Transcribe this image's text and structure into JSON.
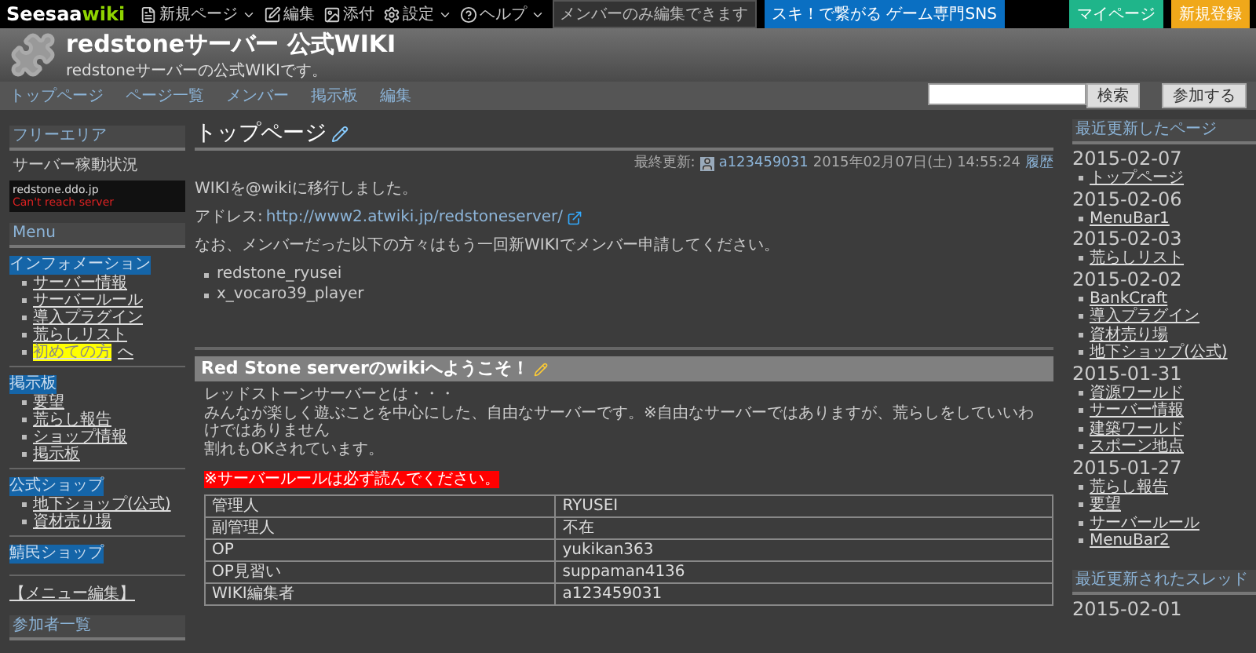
{
  "topbar": {
    "logo": {
      "part_1": "Seesaa",
      "part_2": "wiki"
    },
    "menus": [
      {
        "label": "新規ページ",
        "kind": "dropdown"
      },
      {
        "label": "編集",
        "kind": "plain"
      },
      {
        "label": "添付",
        "kind": "plain"
      },
      {
        "label": "設定",
        "kind": "dropdown"
      },
      {
        "label": "ヘルプ",
        "kind": "dropdown"
      }
    ],
    "notice": "メンバーのみ編集できます",
    "banner": "スキ！で繋がる ゲーム専門SNS",
    "buttons": [
      {
        "label": "マイページ",
        "color": "#1fb58a"
      },
      {
        "label": "新規登録",
        "color": "#f0a81a"
      }
    ]
  },
  "header": {
    "title": "redstoneサーバー 公式WIKI",
    "subtitle": "redstoneサーバーの公式WIKIです。"
  },
  "nav": {
    "links": [
      "トップページ",
      "ページ一覧",
      "メンバー",
      "掲示板",
      "編集"
    ],
    "search_button": "検索",
    "join_button": "参加する"
  },
  "sidebar": {
    "free_area_title": "フリーエリア",
    "status_label": "サーバー稼動状況",
    "server_host": "redstone.ddo.jp",
    "server_status": "Can't reach server",
    "menu_title": "Menu",
    "sections": [
      {
        "title": "インフォメーション",
        "items": [
          {
            "label": "サーバー情報",
            "highlight": false
          },
          {
            "label": "サーバールール",
            "highlight": false
          },
          {
            "label": "導入プラグイン",
            "highlight": false
          },
          {
            "label": "荒らしリスト",
            "highlight": false
          },
          {
            "label": "初めての方",
            "highlight": true,
            "suffix": "へ"
          }
        ]
      },
      {
        "title": "掲示板",
        "items": [
          {
            "label": "要望",
            "highlight": false
          },
          {
            "label": "荒らし報告",
            "highlight": false
          },
          {
            "label": "ショップ情報",
            "highlight": false
          },
          {
            "label": "掲示板",
            "highlight": false
          }
        ]
      },
      {
        "title": "公式ショップ",
        "items": [
          {
            "label": "地下ショップ(公式)",
            "highlight": false
          },
          {
            "label": "資材売り場",
            "highlight": false
          }
        ]
      },
      {
        "title": "鯖民ショップ"
      }
    ],
    "menu_edit": "【メニュー編集】",
    "members_title": "参加者一覧"
  },
  "page": {
    "title": "トップページ",
    "updated_label": "最終更新:",
    "updated_by": "a123459031",
    "updated_at": "2015年02月07日(土) 14:55:24",
    "history": "履歴",
    "intro": "WIKIを@wikiに移行しました。",
    "address_label": "アドレス:",
    "address_link": "http://www2.atwiki.jp/redstoneserver/",
    "notice": "なお、メンバーだった以下の方々はもう一回新WIKIでメンバー申請してください。",
    "members": [
      "redstone_ryusei",
      "x_vocaro39_player"
    ],
    "section_title": "Red Stone serverのwikiへようこそ！",
    "section_lines": [
      "レッドストーンサーバーとは・・・",
      "みんなが楽しく遊ぶことを中心にした、自由なサーバーです。※自由なサーバーではありますが、荒らしをしていいわけではありません",
      "割れもOKされています。"
    ],
    "warning": "※サーバールールは必ず読んでください。",
    "table": {
      "rows": [
        [
          "管理人",
          "RYUSEI"
        ],
        [
          "副管理人",
          "不在"
        ],
        [
          "OP",
          "yukikan363"
        ],
        [
          "OP見習い",
          "suppaman4136"
        ],
        [
          "WIKI編集者",
          "a123459031"
        ]
      ]
    }
  },
  "right": {
    "recent_title": "最近更新したページ",
    "groups": [
      {
        "date": "2015-02-07",
        "pages": [
          "トップページ"
        ]
      },
      {
        "date": "2015-02-06",
        "pages": [
          "MenuBar1"
        ]
      },
      {
        "date": "2015-02-03",
        "pages": [
          "荒らしリスト"
        ]
      },
      {
        "date": "2015-02-02",
        "pages": [
          "BankCraft",
          "導入プラグイン",
          "資材売り場",
          "地下ショップ(公式)"
        ]
      },
      {
        "date": "2015-01-31",
        "pages": [
          "資源ワールド",
          "サーバー情報",
          "建築ワールド",
          "スポーン地点"
        ]
      },
      {
        "date": "2015-01-27",
        "pages": [
          "荒らし報告",
          "要望",
          "サーバールール",
          "MenuBar2"
        ]
      }
    ],
    "threads_title": "最近更新されたスレッド",
    "threads_date": "2015-02-01"
  }
}
